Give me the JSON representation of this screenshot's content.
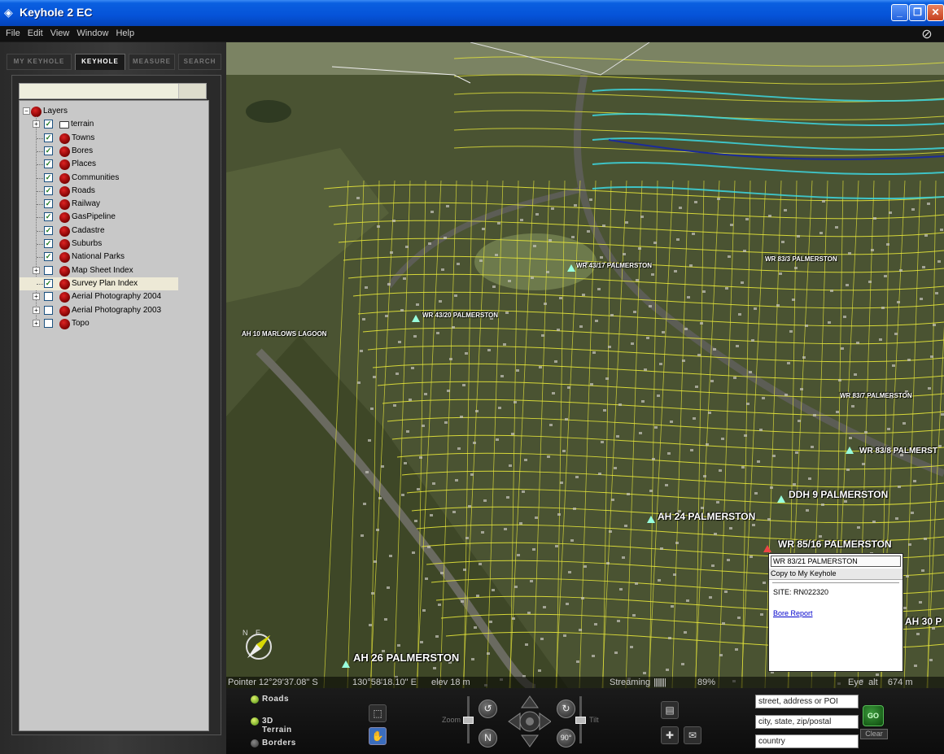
{
  "window": {
    "title": "Keyhole 2 EC",
    "controls": [
      "minimize",
      "restore",
      "close"
    ]
  },
  "menu": [
    "File",
    "Edit",
    "View",
    "Window",
    "Help"
  ],
  "tabs": [
    "MY KEYHOLE",
    "KEYHOLE",
    "MEASURE",
    "SEARCH"
  ],
  "active_tab": "KEYHOLE",
  "layers": {
    "root": "Layers",
    "items": [
      {
        "label": "terrain",
        "checked": true,
        "expandable": true,
        "icon": "folder-icon"
      },
      {
        "label": "Towns",
        "checked": true,
        "expandable": false,
        "icon": "layer-ball-icon"
      },
      {
        "label": "Bores",
        "checked": true,
        "expandable": false,
        "icon": "layer-ball-icon"
      },
      {
        "label": "Places",
        "checked": true,
        "expandable": false,
        "icon": "layer-ball-icon"
      },
      {
        "label": "Communities",
        "checked": true,
        "expandable": false,
        "icon": "layer-ball-icon"
      },
      {
        "label": "Roads",
        "checked": true,
        "expandable": false,
        "icon": "layer-ball-icon"
      },
      {
        "label": "Railway",
        "checked": true,
        "expandable": false,
        "icon": "layer-ball-icon"
      },
      {
        "label": "GasPipeline",
        "checked": true,
        "expandable": false,
        "icon": "layer-ball-icon"
      },
      {
        "label": "Cadastre",
        "checked": true,
        "expandable": false,
        "icon": "layer-ball-icon"
      },
      {
        "label": "Suburbs",
        "checked": true,
        "expandable": false,
        "icon": "layer-ball-icon"
      },
      {
        "label": "National Parks",
        "checked": true,
        "expandable": false,
        "icon": "layer-ball-icon"
      },
      {
        "label": "Map Sheet Index",
        "checked": false,
        "expandable": true,
        "icon": "layer-ball-icon"
      },
      {
        "label": "Survey Plan Index",
        "checked": true,
        "expandable": false,
        "icon": "layer-ball-icon",
        "selected": true
      },
      {
        "label": "Aerial Photography 2004",
        "checked": false,
        "expandable": true,
        "icon": "layer-ball-icon"
      },
      {
        "label": "Aerial Photography 2003",
        "checked": false,
        "expandable": true,
        "icon": "layer-ball-icon"
      },
      {
        "label": "Topo",
        "checked": false,
        "expandable": true,
        "icon": "layer-ball-icon"
      }
    ]
  },
  "map_labels": {
    "wr_43_17": "WR 43/17 PALMERSTON",
    "wr_83_3": "WR 83/3 PALMERSTON",
    "wr_43_20": "WR 43/20 PALMERSTON",
    "ah_10": "AH 10 MARLOWS LAGOON",
    "wr_83_7": "WR 83/7 PALMERSTON",
    "wr_83_8": "WR 83/8 PALMERST",
    "ddh_9": "DDH 9 PALMERSTON",
    "ah_24": "AH 24 PALMERSTON",
    "wr_85_16": "WR 85/16 PALMERSTON",
    "ah_30": "AH 30 P",
    "ah_26": "AH 26 PALMERSTON"
  },
  "popup": {
    "title": "WR 83/21 PALMERSTON",
    "copy_action": "Copy to My Keyhole",
    "site": "SITE: RN022320",
    "link": "Bore Report"
  },
  "status": {
    "pointer": "Pointer 12°29'37.08\" S",
    "longitude": "130°58'18.10\" E",
    "elev": "elev  18 m",
    "streaming_label": "Streaming",
    "streaming_bars": "||||||||",
    "streaming_pct": "89%",
    "eye_alt": "Eye  alt    674 m"
  },
  "controls": {
    "roads": "Roads",
    "terrain3d": "3D Terrain",
    "borders": "Borders",
    "zoom": "Zoom",
    "tilt": "Tilt",
    "rotate_90": "90°",
    "address_placeholder": "street, address or POI",
    "city_placeholder": "city, state, zip/postal",
    "country_placeholder": "country",
    "go": "GO",
    "clear": "Clear"
  },
  "colors": {
    "accent_blue": "#0553d8",
    "cadastre_line": "#e6e63a",
    "road_line": "#3cd7e0",
    "highlight_row": "#ede9d6"
  }
}
